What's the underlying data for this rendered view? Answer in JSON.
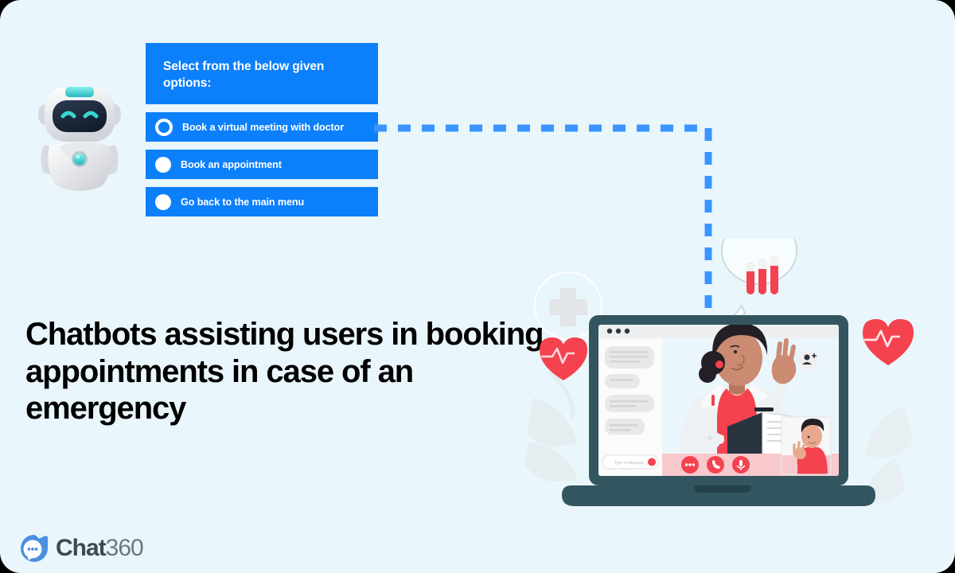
{
  "page": {
    "background_color": "#e9f6fc",
    "accent_color": "#0c7ffb",
    "headline": "Chatbots assisting users in booking appointments in case of an emergency"
  },
  "bot": {
    "avatar_icon": "robot-mascot-icon",
    "header_text": "Select from the below given options:",
    "options": [
      {
        "label": "Book a virtual meeting with doctor",
        "radio": "ring",
        "selected": true
      },
      {
        "label": "Book an appointment",
        "radio": "filled",
        "selected": false
      },
      {
        "label": "Go back to the main menu",
        "radio": "filled",
        "selected": false
      }
    ]
  },
  "connector": {
    "style": "dashed",
    "color": "#3b95ff"
  },
  "illustration": {
    "name": "telemedicine-video-call",
    "laptop_color": "#33555f",
    "screen": {
      "window_dots": 3,
      "chat_panel": {
        "message_bubbles": 4,
        "input_placeholder": "Type a message...",
        "send_button_icon": "send-icon"
      },
      "video": {
        "doctor": "doctor-waving",
        "add_person_icon": "add-person-icon",
        "thumbnail": "patient-waving-thumbnail",
        "controls": [
          {
            "icon": "more-icon"
          },
          {
            "icon": "phone-icon"
          },
          {
            "icon": "microphone-icon"
          }
        ]
      }
    },
    "decorations": [
      {
        "name": "medical-cross-icon"
      },
      {
        "name": "heart-pulse-icon-left"
      },
      {
        "name": "heart-pulse-icon-right"
      },
      {
        "name": "pill-speech-bubble-icon"
      },
      {
        "name": "leaf-decoration-left"
      },
      {
        "name": "leaf-decoration-right"
      }
    ]
  },
  "logo": {
    "icon": "chat360-bubble-icon",
    "name_bold": "Chat",
    "name_light": "360"
  }
}
